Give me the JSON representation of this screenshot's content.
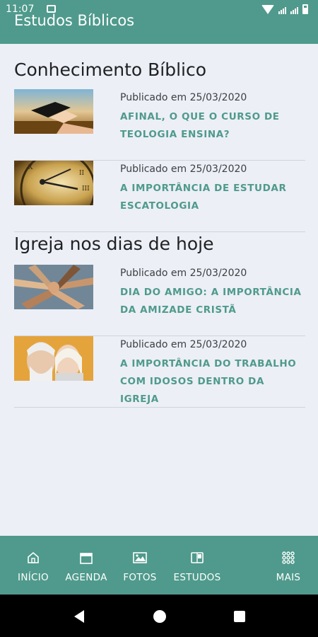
{
  "status_bar": {
    "time": "11:07"
  },
  "app_bar": {
    "title": "Estudos Bíblicos"
  },
  "sections": [
    {
      "title": "Conhecimento Bíblico",
      "items": [
        {
          "published": "Publicado em 25/03/2020",
          "headline": "AFINAL, O QUE O CURSO DE TEOLOGIA ENSINA?"
        },
        {
          "published": "Publicado em 25/03/2020",
          "headline": "A IMPORTÂNCIA DE ESTUDAR ESCATOLOGIA"
        }
      ]
    },
    {
      "title": "Igreja nos dias de hoje",
      "items": [
        {
          "published": "Publicado em 25/03/2020",
          "headline": "DIA DO AMIGO: A IMPORTÂNCIA DA AMIZADE CRISTÃ"
        },
        {
          "published": "Publicado em 25/03/2020",
          "headline": "A IMPORTÂNCIA DO TRABALHO COM IDOSOS DENTRO DA IGREJA"
        }
      ]
    }
  ],
  "bottom_nav": {
    "tabs": [
      {
        "label": "INÍCIO",
        "icon": "home-icon"
      },
      {
        "label": "AGENDA",
        "icon": "calendar-icon"
      },
      {
        "label": "FOTOS",
        "icon": "photos-icon"
      },
      {
        "label": "ESTUDOS",
        "icon": "book-icon"
      },
      {
        "label": "MAIS",
        "icon": "grid-icon"
      }
    ]
  },
  "colors": {
    "primary": "#4f9a8c",
    "background": "#eceff6",
    "headline": "#4f9a8c"
  }
}
